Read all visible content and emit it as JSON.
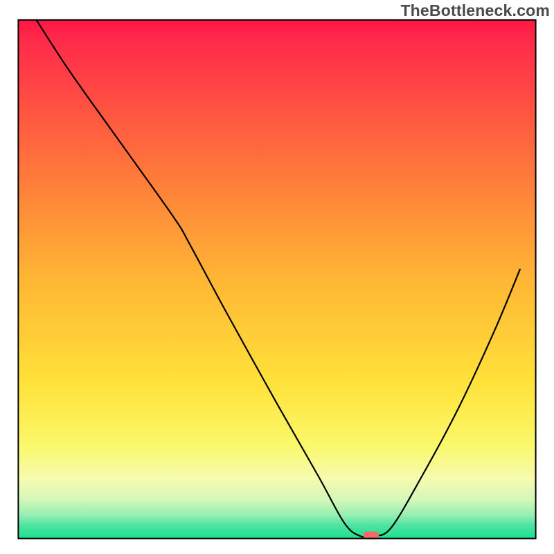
{
  "watermark": "TheBottleneck.com",
  "chart_data": {
    "type": "line",
    "title": "",
    "xlabel": "",
    "ylabel": "",
    "xlim": [
      0,
      100
    ],
    "ylim": [
      0,
      100
    ],
    "background_gradient": {
      "stops": [
        {
          "offset": 0.0,
          "color": "#ff1744"
        },
        {
          "offset": 0.04,
          "color": "#ff2a4a"
        },
        {
          "offset": 0.3,
          "color": "#ff7a3a"
        },
        {
          "offset": 0.5,
          "color": "#ffb634"
        },
        {
          "offset": 0.7,
          "color": "#ffe23a"
        },
        {
          "offset": 0.82,
          "color": "#faf86a"
        },
        {
          "offset": 0.885,
          "color": "#f6fbb0"
        },
        {
          "offset": 0.925,
          "color": "#d4f7b8"
        },
        {
          "offset": 0.955,
          "color": "#96efb3"
        },
        {
          "offset": 0.975,
          "color": "#4de3a0"
        },
        {
          "offset": 1.0,
          "color": "#19e38f"
        }
      ]
    },
    "series": [
      {
        "name": "bottleneck-curve",
        "color": "#000000",
        "x": [
          3.5,
          10,
          20,
          30,
          33,
          40,
          50,
          58,
          63,
          66,
          68.5,
          72,
          78,
          85,
          92,
          97
        ],
        "y": [
          100,
          90,
          76,
          62,
          57,
          44,
          26,
          12,
          3,
          0.5,
          0.5,
          2,
          12,
          25,
          40,
          52
        ]
      }
    ],
    "marker": {
      "name": "optimal-point",
      "x": 68.2,
      "y": 0.6,
      "width_pct": 3.0,
      "height_pct": 1.5,
      "color": "#f46a6a"
    },
    "frame": {
      "x": 3.3,
      "y": 3.6,
      "width": 93.4,
      "height": 93.6,
      "stroke": "#000000",
      "stroke_width": 2
    }
  }
}
